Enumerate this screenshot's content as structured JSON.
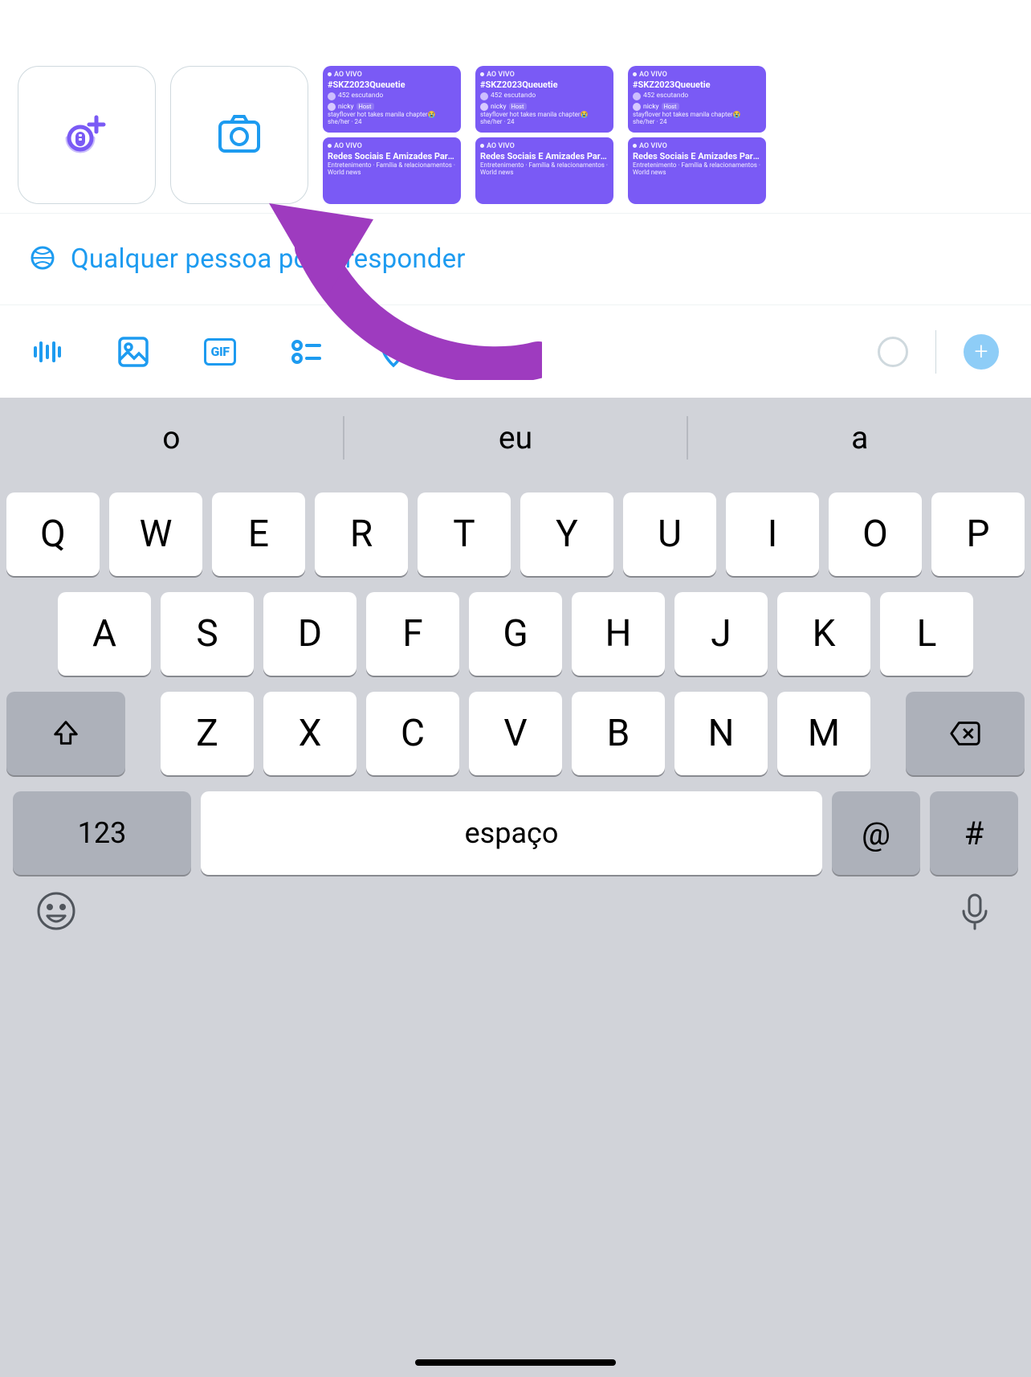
{
  "media_row": {
    "spaces_create_icon": "spaces-create",
    "camera_icon": "camera"
  },
  "space_cards": {
    "live_label": "AO VIVO",
    "card1": {
      "title": "#SKZ2023Queuetie",
      "listeners": "452 escutando",
      "host_name": "nicky",
      "host_badge": "Host",
      "desc": "stayflover hot takes manila chapter😭 she/her · 24"
    },
    "card2": {
      "title": "Redes Sociais E Amizades Para A Vida😢😊😊",
      "category": "Entretenimento · Família & relacionamentos · World news"
    }
  },
  "reply_scope": {
    "text": "Qualquer pessoa pode responder"
  },
  "toolbar": {
    "voice": "voice",
    "image": "image",
    "gif": "GIF",
    "poll": "poll",
    "location": "location"
  },
  "keyboard": {
    "suggestions": [
      "o",
      "eu",
      "a"
    ],
    "row1": [
      "Q",
      "W",
      "E",
      "R",
      "T",
      "Y",
      "U",
      "I",
      "O",
      "P"
    ],
    "row2": [
      "A",
      "S",
      "D",
      "F",
      "G",
      "H",
      "J",
      "K",
      "L"
    ],
    "row3": [
      "Z",
      "X",
      "C",
      "V",
      "B",
      "N",
      "M"
    ],
    "num_key": "123",
    "space_label": "espaço",
    "at_key": "@",
    "hash_key": "#"
  }
}
